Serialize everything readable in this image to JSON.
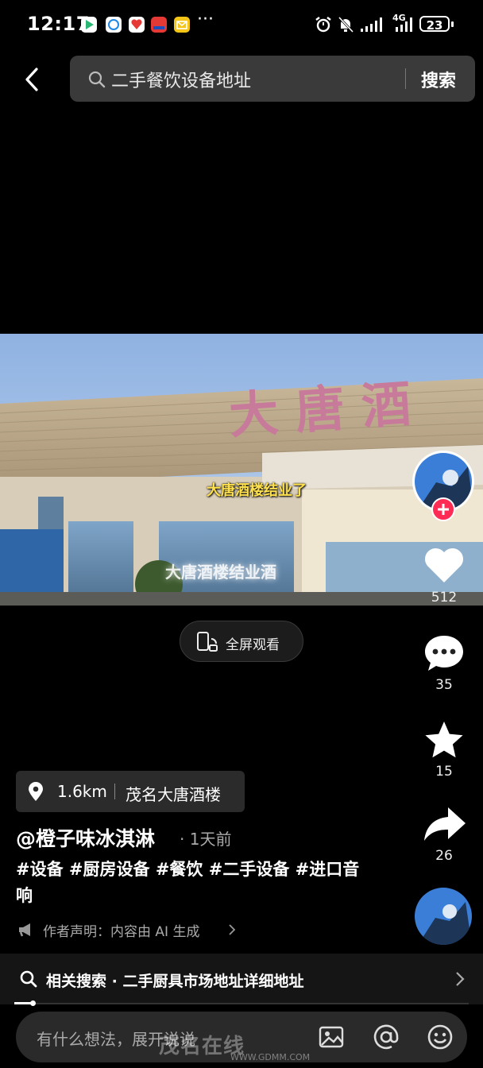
{
  "status_bar": {
    "time": "12:17",
    "more": "···",
    "network": "4G",
    "battery": "23"
  },
  "search": {
    "query": "二手餐饮设备地址",
    "button": "搜索"
  },
  "video": {
    "caption_top": "大唐酒楼结业了",
    "caption_bottom": "大唐酒楼结业酒"
  },
  "fullscreen_label": "全屏观看",
  "actions": {
    "likes": "512",
    "comments": "35",
    "favorites": "15",
    "shares": "26"
  },
  "location": {
    "distance": "1.6km",
    "name": "茂名大唐酒楼"
  },
  "post": {
    "author": "@橙子味冰淇淋",
    "time": "· 1天前",
    "tags": "#设备 #厨房设备 #餐饮 #二手设备 #进口音响",
    "declaration": "作者声明：内容由 AI 生成"
  },
  "related_search": "相关搜索 · 二手厨具市场地址详细地址",
  "comment_placeholder": "有什么想法，展开说说",
  "watermark": {
    "text": "茂名在线",
    "url": "WWW.GDMM.COM"
  },
  "colors": {
    "follow_plus": "#fe2c55",
    "caption_yellow": "#ffe14d"
  }
}
